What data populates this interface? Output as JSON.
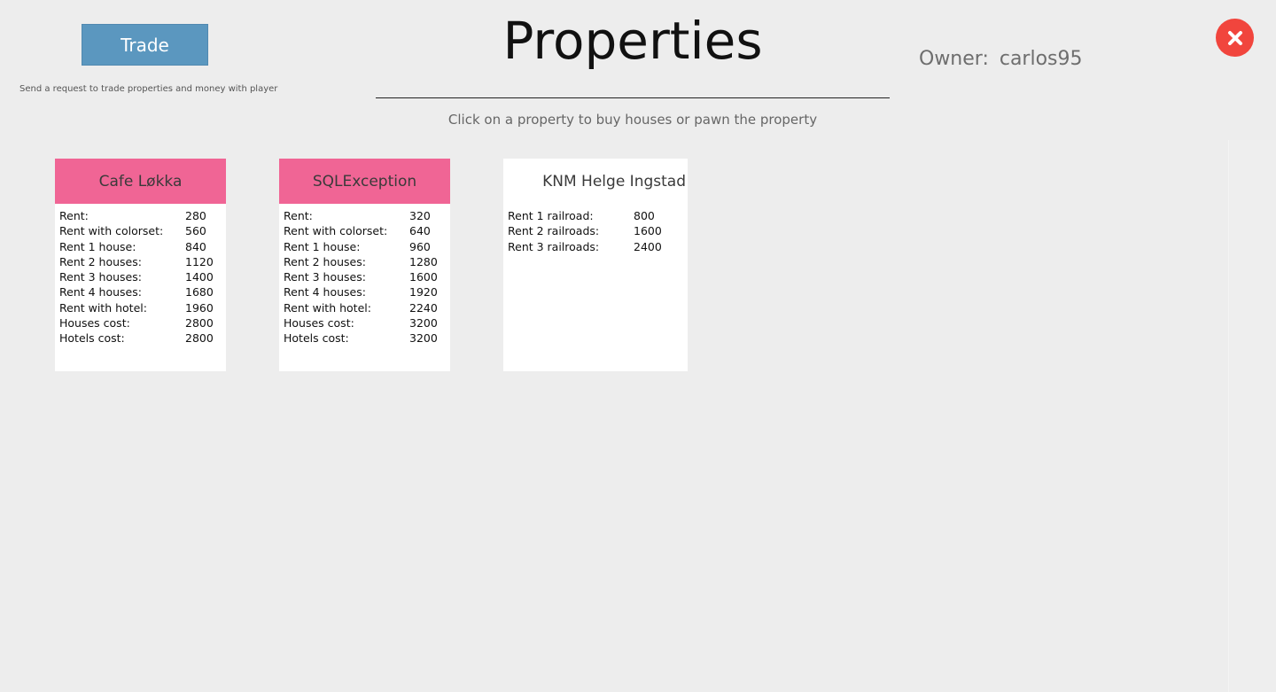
{
  "header": {
    "trade_label": "Trade",
    "trade_hint": "Send a request to trade properties and money with player",
    "title": "Properties",
    "subtitle": "Click on a property to buy houses or pawn the property",
    "owner_label": "Owner:",
    "owner_name": "carlos95",
    "close_icon": "close-icon"
  },
  "colors": {
    "accent_button": "#5b97bf",
    "street_color": "#f06595",
    "close": "#f1453d"
  },
  "cards": [
    {
      "name": "Cafe Løkka",
      "rows": [
        {
          "label": "Rent:",
          "value": "280"
        },
        {
          "label": "Rent with colorset:",
          "value": "560"
        },
        {
          "label": "Rent 1 house:",
          "value": "840"
        },
        {
          "label": "Rent 2 houses:",
          "value": "1120"
        },
        {
          "label": "Rent 3 houses:",
          "value": "1400"
        },
        {
          "label": "Rent 4 houses:",
          "value": "1680"
        },
        {
          "label": "Rent with hotel:",
          "value": "1960"
        },
        {
          "label": "Houses cost:",
          "value": "2800"
        },
        {
          "label": "Hotels cost:",
          "value": "2800"
        }
      ]
    },
    {
      "name": "SQLException",
      "rows": [
        {
          "label": "Rent:",
          "value": "320"
        },
        {
          "label": "Rent with colorset:",
          "value": "640"
        },
        {
          "label": "Rent 1 house:",
          "value": "960"
        },
        {
          "label": "Rent 2 houses:",
          "value": "1280"
        },
        {
          "label": "Rent 3 houses:",
          "value": "1600"
        },
        {
          "label": "Rent 4 houses:",
          "value": "1920"
        },
        {
          "label": "Rent with hotel:",
          "value": "2240"
        },
        {
          "label": "Houses cost:",
          "value": "3200"
        },
        {
          "label": "Hotels cost:",
          "value": "3200"
        }
      ]
    },
    {
      "name": "KNM Helge Ingstad",
      "rows": [
        {
          "label": "Rent 1 railroad:",
          "value": "800"
        },
        {
          "label": "Rent 2 railroads:",
          "value": "1600"
        },
        {
          "label": "Rent 3 railroads:",
          "value": "2400"
        }
      ]
    }
  ]
}
